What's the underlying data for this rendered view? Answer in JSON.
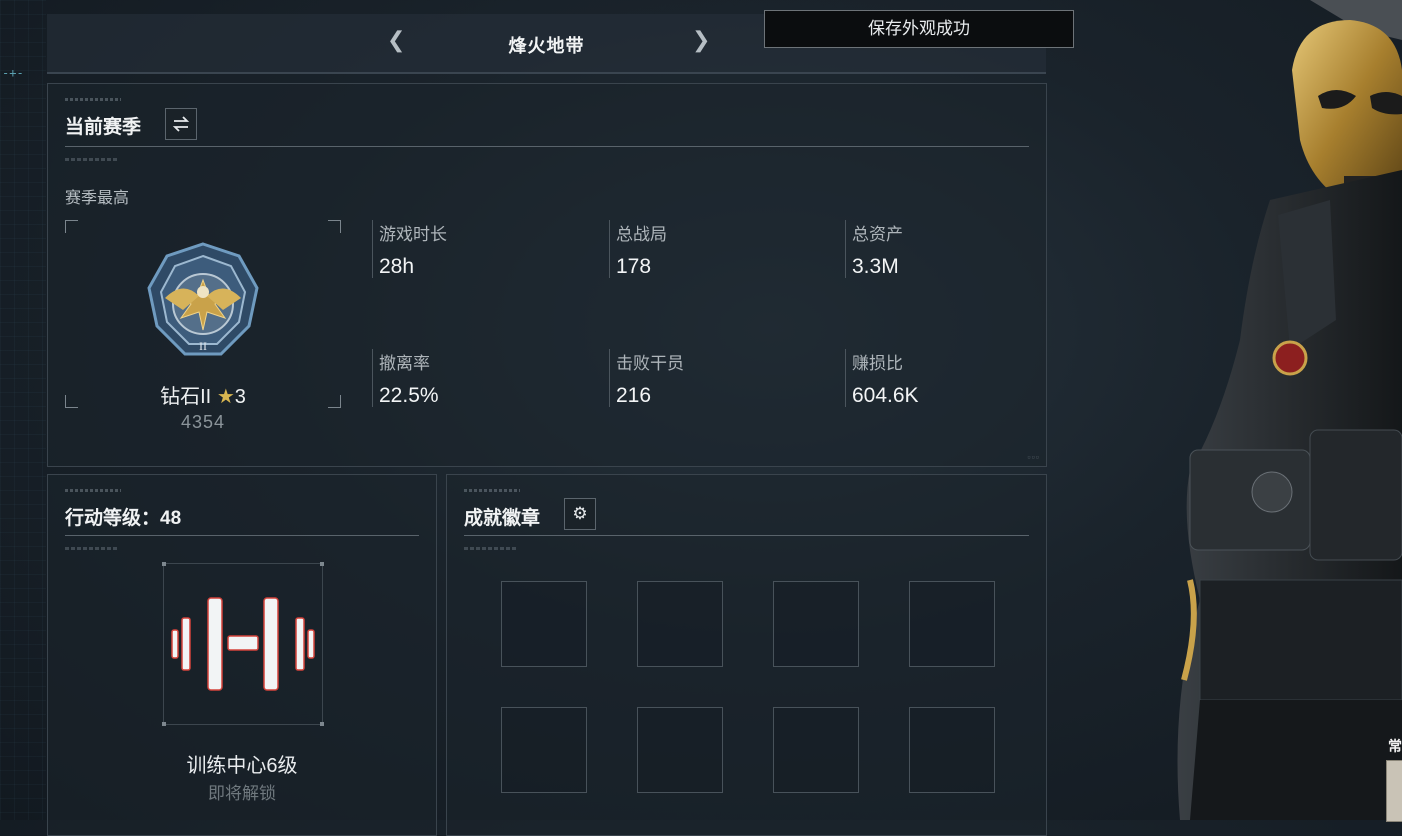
{
  "header": {
    "title": "烽火地带",
    "prev_icon": "chevron-left-icon",
    "next_icon": "chevron-right-icon"
  },
  "toast": {
    "text": "保存外观成功"
  },
  "season": {
    "heading": "当前赛季",
    "switch_icon": "swap-arrows-icon",
    "best_label": "赛季最高",
    "rank": {
      "name": "钻石II",
      "stars": "3",
      "star_icon": "star-icon",
      "score": "4354"
    },
    "stats": [
      {
        "label": "游戏时长",
        "value": "28h"
      },
      {
        "label": "总战局",
        "value": "178"
      },
      {
        "label": "总资产",
        "value": "3.3M"
      },
      {
        "label": "撤离率",
        "value": "22.5%"
      },
      {
        "label": "击败干员",
        "value": "216"
      },
      {
        "label": "赚损比",
        "value": "604.6K"
      }
    ]
  },
  "level": {
    "heading": "行动等级：48",
    "icon": "dumbbell-icon",
    "title": "训练中心6级",
    "subtitle": "即将解锁"
  },
  "badges": {
    "heading": "成就徽章",
    "settings_icon": "gear-icon",
    "slots": 8
  },
  "side": {
    "label": "常"
  },
  "colors": {
    "accent_gold": "#c9a24a",
    "frame_blue": "#3f6f93",
    "panel_border": "#3a444d"
  }
}
